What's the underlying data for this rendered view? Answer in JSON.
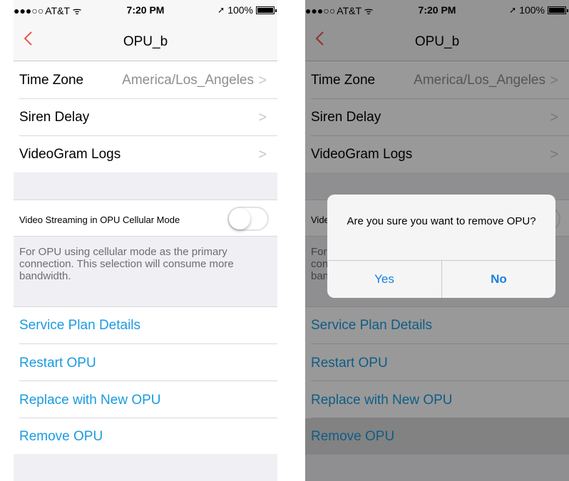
{
  "status_bar": {
    "signal": "●●●○○",
    "carrier": "AT&T",
    "wifi": "ᯤ",
    "time": "7:20 PM",
    "location_arrow": "➚",
    "battery": "100%"
  },
  "nav": {
    "back_icon": "chevron-left-icon",
    "title": "OPU_b"
  },
  "settings": {
    "time_zone_label": "Time Zone",
    "time_zone_value": "America/Los_Angeles",
    "siren_delay_label": "Siren Delay",
    "videogram_logs_label": "VideoGram Logs",
    "chevron": ">"
  },
  "streaming": {
    "label": "Video Streaming in OPU Cellular Mode",
    "enabled": false,
    "note": "For OPU using cellular mode as the primary connection. This selection will consume more bandwidth."
  },
  "actions": {
    "service_plan": "Service Plan Details",
    "restart": "Restart OPU",
    "replace": "Replace with New OPU",
    "remove": "Remove OPU"
  },
  "dialog": {
    "message": "Are you sure you want to remove OPU?",
    "yes": "Yes",
    "no": "No"
  },
  "colors": {
    "link": "#1a9be0",
    "nav_back": "#e8574d",
    "dialog_button": "#1a7fe0"
  }
}
